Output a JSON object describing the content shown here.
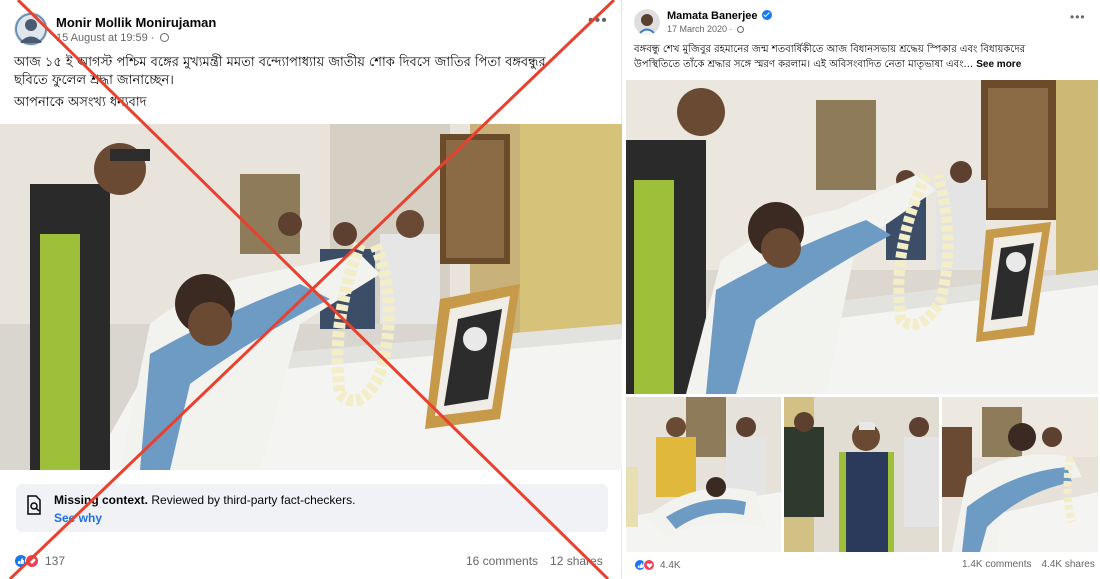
{
  "left_post": {
    "author": "Monir Mollik Monirujaman",
    "timestamp": "15 August at 19:59 ·",
    "audience_icon": "globe-icon",
    "more_icon": "more-options-icon",
    "text_line1": "আজ ১৫ ই আগস্ট পশ্চিম বঙ্গের মুখ্যমন্ত্রী মমতা বন্দ্যোপাধ্যায় জাতীয় শোক দিবসে জাতির পিতা বঙ্গবন্ধুর",
    "text_line2": "ছবিতে ফুলেল শ্রদ্ধা জানাচ্ছেন।",
    "text_line3": "আপনাকে অসংখ্য ধন্যবাদ",
    "fact_check": {
      "title_bold": "Missing context.",
      "title_rest": " Reviewed by third-party fact-checkers.",
      "link": "See why"
    },
    "reactions_count": "137",
    "comments": "16 comments",
    "shares": "12 shares"
  },
  "right_post": {
    "author": "Mamata Banerjee",
    "timestamp": "17 March 2020 ·",
    "audience_icon": "globe-icon",
    "more_icon": "more-options-icon",
    "text_line1": "বঙ্গবন্ধু শেখ মুজিবুর রহমানের জন্ম শতবার্ষিকীতে আজ বিধানসভায় শ্রদ্ধেয় স্পিকার এবং বিধায়কদের",
    "text_line2": "উপস্থিতিতে তাঁকে শ্রদ্ধার সঙ্গে স্মরণ করলাম। এই অবিসংবাদিত নেতা মাতৃভাষা এবং...",
    "see_more": "See more",
    "reactions_count": "4.4K",
    "comments": "1.4K comments",
    "shares": "4.4K shares"
  },
  "colors": {
    "facebook_blue": "#1877f2",
    "x_overlay": "#e8412f",
    "love_red": "#f33e58"
  }
}
